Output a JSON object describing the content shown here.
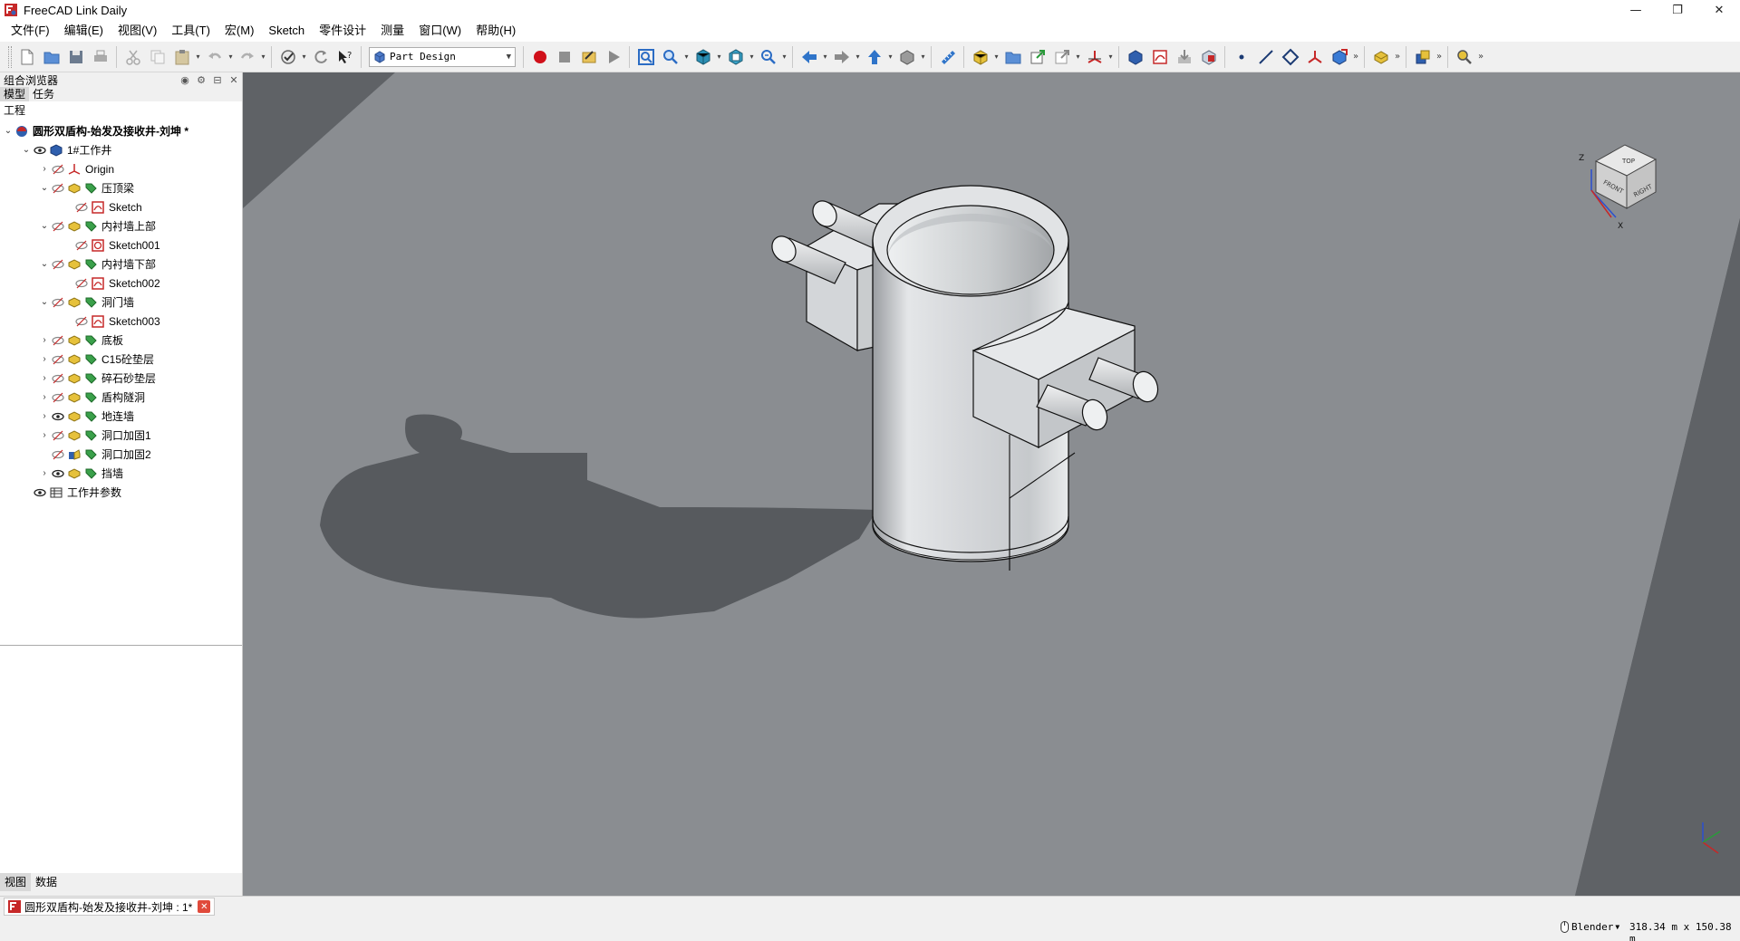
{
  "window": {
    "title": "FreeCAD Link Daily"
  },
  "menus": [
    "文件(F)",
    "编辑(E)",
    "视图(V)",
    "工具(T)",
    "宏(M)",
    "Sketch",
    "零件设计",
    "测量",
    "窗口(W)",
    "帮助(H)"
  ],
  "toolbar": {
    "workbench": "Part Design"
  },
  "panel": {
    "title": "组合浏览器",
    "tabs": [
      "模型",
      "任务"
    ],
    "tree_header": "工程",
    "items": [
      {
        "label": "圆形双盾构-始发及接收井-刘坤 *"
      },
      {
        "label": "1#工作井"
      },
      {
        "label": "Origin"
      },
      {
        "label": "压顶梁"
      },
      {
        "label": "Sketch"
      },
      {
        "label": "内衬墙上部"
      },
      {
        "label": "Sketch001"
      },
      {
        "label": "内衬墙下部"
      },
      {
        "label": "Sketch002"
      },
      {
        "label": "洞门墙"
      },
      {
        "label": "Sketch003"
      },
      {
        "label": "底板"
      },
      {
        "label": "C15砼垫层"
      },
      {
        "label": "碎石砂垫层"
      },
      {
        "label": "盾构隧洞"
      },
      {
        "label": "地连墙"
      },
      {
        "label": "洞口加固1"
      },
      {
        "label": "洞口加固2"
      },
      {
        "label": "挡墙"
      },
      {
        "label": "工作井参数"
      }
    ],
    "bottom_tabs": [
      "视图",
      "数据"
    ]
  },
  "document_tab": {
    "label": "圆形双盾构-始发及接收井-刘坤 : 1*"
  },
  "status": {
    "nav_style": "Blender",
    "dimensions": "318.34 m x 150.38 m"
  },
  "navcube": {
    "faces": [
      "TOP",
      "FRONT",
      "RIGHT"
    ],
    "axes": [
      "Z",
      "X"
    ]
  },
  "colors": {
    "viewport": "#5f6266",
    "ground": "#8a8d91",
    "shadow": "#575a5e",
    "model": "#d8dadd"
  }
}
